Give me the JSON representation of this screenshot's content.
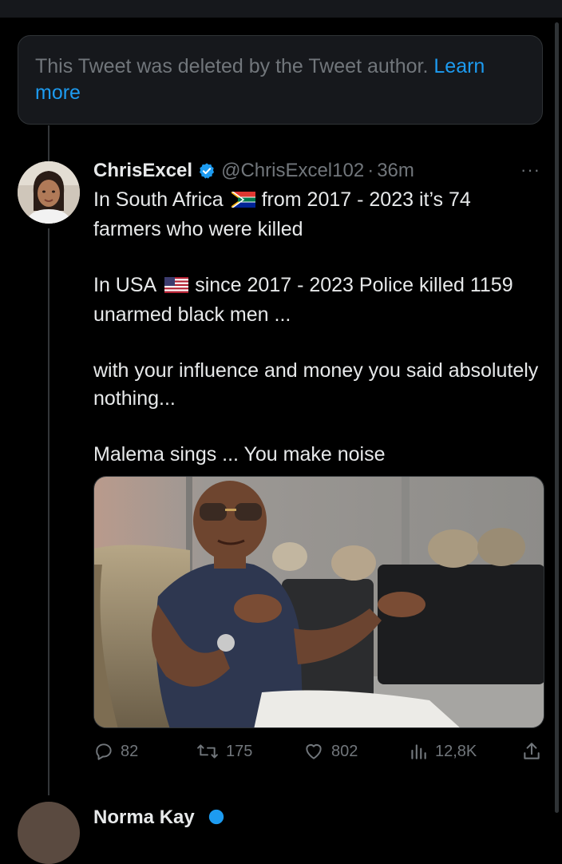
{
  "deleted_notice": {
    "text": "This Tweet was deleted by the Tweet author.",
    "link": "Learn more"
  },
  "tweet": {
    "author_name": "ChrisExcel",
    "handle": "@ChrisExcel102",
    "separator": "·",
    "time": "36m",
    "more": "···",
    "lines": {
      "l1a": "In South Africa",
      "l1b": "from 2017 - 2023 it’s 74 farmers who were killed",
      "l2a": "In USA",
      "l2b": "since 2017 - 2023  Police killed 1159 unarmed black men ...",
      "l3": "with your influence and money you said absolutely nothing...",
      "l4": "Malema sings ... You make noise"
    },
    "stats": {
      "replies": "82",
      "retweets": "175",
      "likes": "802",
      "views": "12,8K"
    }
  },
  "next_tweet": {
    "author_name": "Norma Kay"
  },
  "icons": [
    "verified-badge-icon",
    "south-africa-flag-icon",
    "usa-flag-icon",
    "reply-icon",
    "retweet-icon",
    "like-icon",
    "views-icon",
    "share-icon",
    "more-icon"
  ],
  "colors": {
    "accent": "#1d9bf0",
    "muted": "#71767b",
    "background": "#000000",
    "text": "#e7e9ea"
  }
}
